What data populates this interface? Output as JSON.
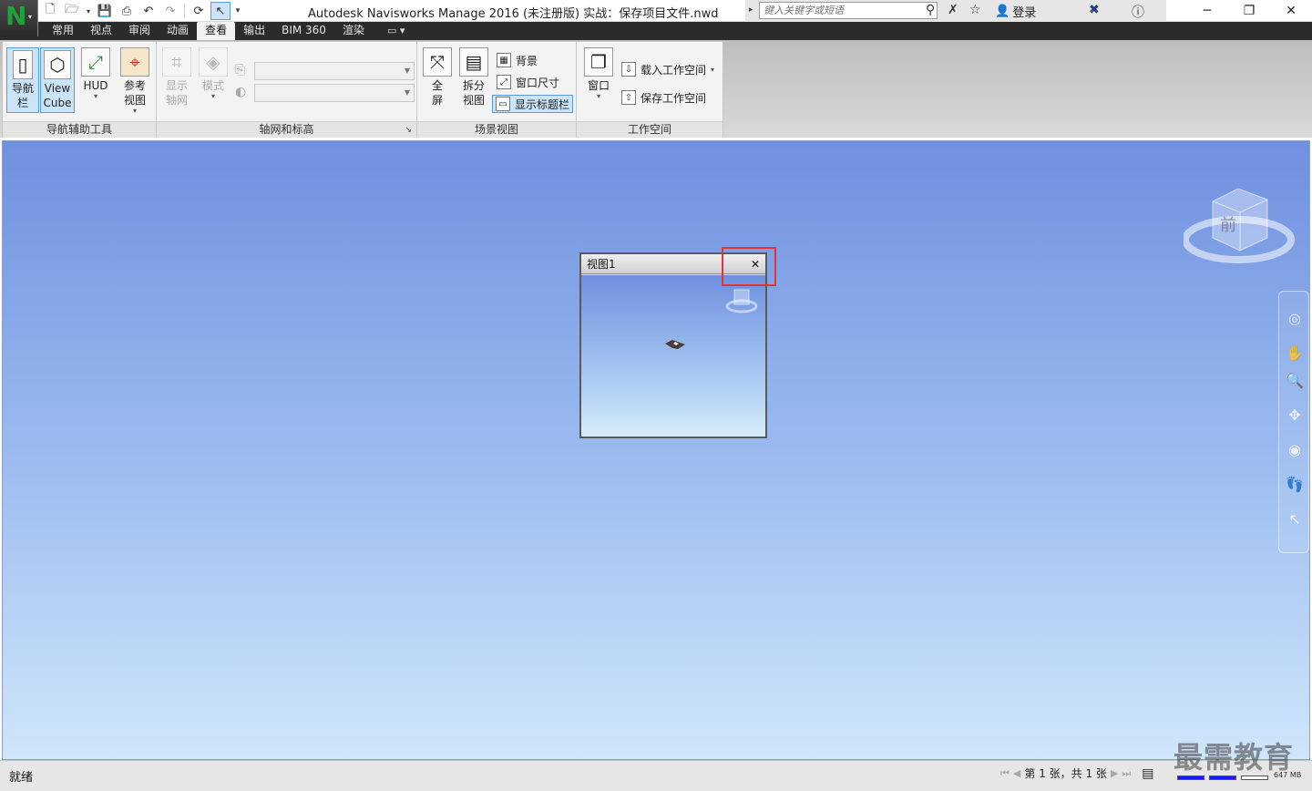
{
  "window": {
    "title": "Autodesk Navisworks Manage 2016 (未注册版)     实战：保存项目文件.nwd",
    "minimize_glyph": "─",
    "restore_glyph": "❐",
    "close_glyph": "✕"
  },
  "app_menu": {
    "logo_letter": "N"
  },
  "search": {
    "placeholder": "键入关键字或短语"
  },
  "account": {
    "login_label": "登录"
  },
  "tabs": [
    {
      "label": "常用",
      "active": false
    },
    {
      "label": "视点",
      "active": false
    },
    {
      "label": "审阅",
      "active": false
    },
    {
      "label": "动画",
      "active": false
    },
    {
      "label": "查看",
      "active": true
    },
    {
      "label": "输出",
      "active": false
    },
    {
      "label": "BIM 360",
      "active": false
    },
    {
      "label": "渲染",
      "active": false
    }
  ],
  "ribbon": {
    "nav_tools": {
      "title": "导航辅助工具",
      "navbar_label_1": "导航",
      "navbar_label_2": "栏",
      "viewcube_label_1": "View",
      "viewcube_label_2": "Cube",
      "hud_label": "HUD",
      "refview_label_1": "参考",
      "refview_label_2": "视图"
    },
    "grid_levels": {
      "title": "轴网和标高",
      "show_grid_1": "显示",
      "show_grid_2": "轴网",
      "mode_label": "模式"
    },
    "scene_view": {
      "title": "场景视图",
      "fullscreen_1": "全",
      "fullscreen_2": "屏",
      "split_1": "拆分",
      "split_2": "视图",
      "background_label": "背景",
      "window_size_label": "窗口尺寸",
      "show_title_bar_label": "显示标题栏"
    },
    "workspace": {
      "title": "工作空间",
      "window_label": "窗口",
      "load_workspace_label": "载入工作空间",
      "save_workspace_label": "保存工作空间"
    }
  },
  "viewcube": {
    "face_label": "前"
  },
  "view_window": {
    "title": "视图1",
    "close_glyph": "✕"
  },
  "status": {
    "text": "就绪",
    "sheet_info": "第 1 张，共 1 张",
    "memory": "647 MB",
    "meter_1": 1.0,
    "meter_2": 1.0,
    "meter_3": 0.0
  },
  "watermark": "最需教育"
}
